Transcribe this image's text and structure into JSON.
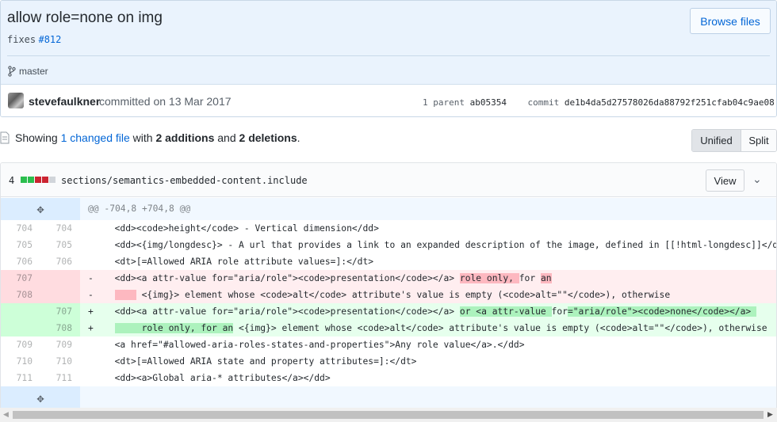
{
  "commit": {
    "title": "allow role=none on img",
    "desc_prefix": "fixes",
    "issue": "#812",
    "browse_label": "Browse files",
    "branch": "master",
    "author": "stevefaulkner",
    "committed_text": "committed on 13 Mar 2017",
    "parent_label": "1 parent",
    "parent_sha": "ab05354",
    "commit_label": "commit",
    "commit_sha": "de1b4da5d27578026da88792f251cfab04c9ae08"
  },
  "summary": {
    "showing": "Showing",
    "changed_link": "1 changed file",
    "with": "with",
    "additions": "2 additions",
    "and": "and",
    "deletions": "2 deletions",
    "period": "."
  },
  "view_toggle": {
    "unified": "Unified",
    "split": "Split",
    "selected": "Unified"
  },
  "file": {
    "change_count": "4",
    "path": "sections/semantics-embedded-content.include",
    "view_label": "View",
    "diffstat": [
      "add",
      "add",
      "del",
      "del",
      "neutral"
    ]
  },
  "hunk_header": "@@ -704,8 +704,8 @@",
  "icons": {
    "expand": "expand-icon",
    "branch": "git-branch-icon",
    "file": "file-diff-icon",
    "chevron": "chevron-down-icon"
  },
  "colors": {
    "link": "#0366d6",
    "del_bg": "#ffeef0",
    "add_bg": "#e6ffed",
    "del_highlight": "#fdb8c0",
    "add_highlight": "#acf2bd"
  },
  "lines": [
    {
      "old": "704",
      "new": "704",
      "type": "ctx",
      "sign": "",
      "text": "<dd><code>height</code> - Vertical dimension</dd>"
    },
    {
      "old": "705",
      "new": "705",
      "type": "ctx",
      "sign": "",
      "text": "<dd><{img/longdesc}> - A url that provides a link to an expanded description of the image, defined in [[!html-longdesc]]</dd>"
    },
    {
      "old": "706",
      "new": "706",
      "type": "ctx",
      "sign": "",
      "text": "<dt>[=Allowed ARIA role attribute values=]:</dt>"
    },
    {
      "old": "707",
      "new": "",
      "type": "del",
      "sign": "-",
      "parts": [
        "<dd><a attr-value for=\"aria/role\"><code>presentation</code></a> ",
        "role only, ",
        "for ",
        "an",
        ""
      ],
      "hl": [
        false,
        true,
        false,
        true,
        false
      ]
    },
    {
      "old": "708",
      "new": "",
      "type": "del",
      "sign": "-",
      "parts": [
        "    ",
        " <{img}> element whose <code>alt</code> attribute's value is empty (<code>alt=\"\"</code>), otherwise"
      ],
      "hl": [
        true,
        false
      ]
    },
    {
      "old": "",
      "new": "707",
      "type": "add",
      "sign": "+",
      "parts": [
        "<dd><a attr-value for=\"aria/role\"><code>presentation</code></a> ",
        "or <a attr-value ",
        "for",
        "=\"aria/role\"><code>none</code></a> "
      ],
      "hl": [
        false,
        true,
        false,
        true
      ]
    },
    {
      "old": "",
      "new": "708",
      "type": "add",
      "sign": "+",
      "parts": [
        "     role only, for an",
        " <{img}> element whose <code>alt</code> attribute's value is empty (<code>alt=\"\"</code>), otherwise"
      ],
      "hl": [
        true,
        false
      ]
    },
    {
      "old": "709",
      "new": "709",
      "type": "ctx",
      "sign": "",
      "text": "<a href=\"#allowed-aria-roles-states-and-properties\">Any role value</a>.</dd>"
    },
    {
      "old": "710",
      "new": "710",
      "type": "ctx",
      "sign": "",
      "text": "<dt>[=Allowed ARIA state and property attributes=]:</dt>"
    },
    {
      "old": "711",
      "new": "711",
      "type": "ctx",
      "sign": "",
      "text": "<dd><a>Global aria-* attributes</a></dd>"
    }
  ]
}
